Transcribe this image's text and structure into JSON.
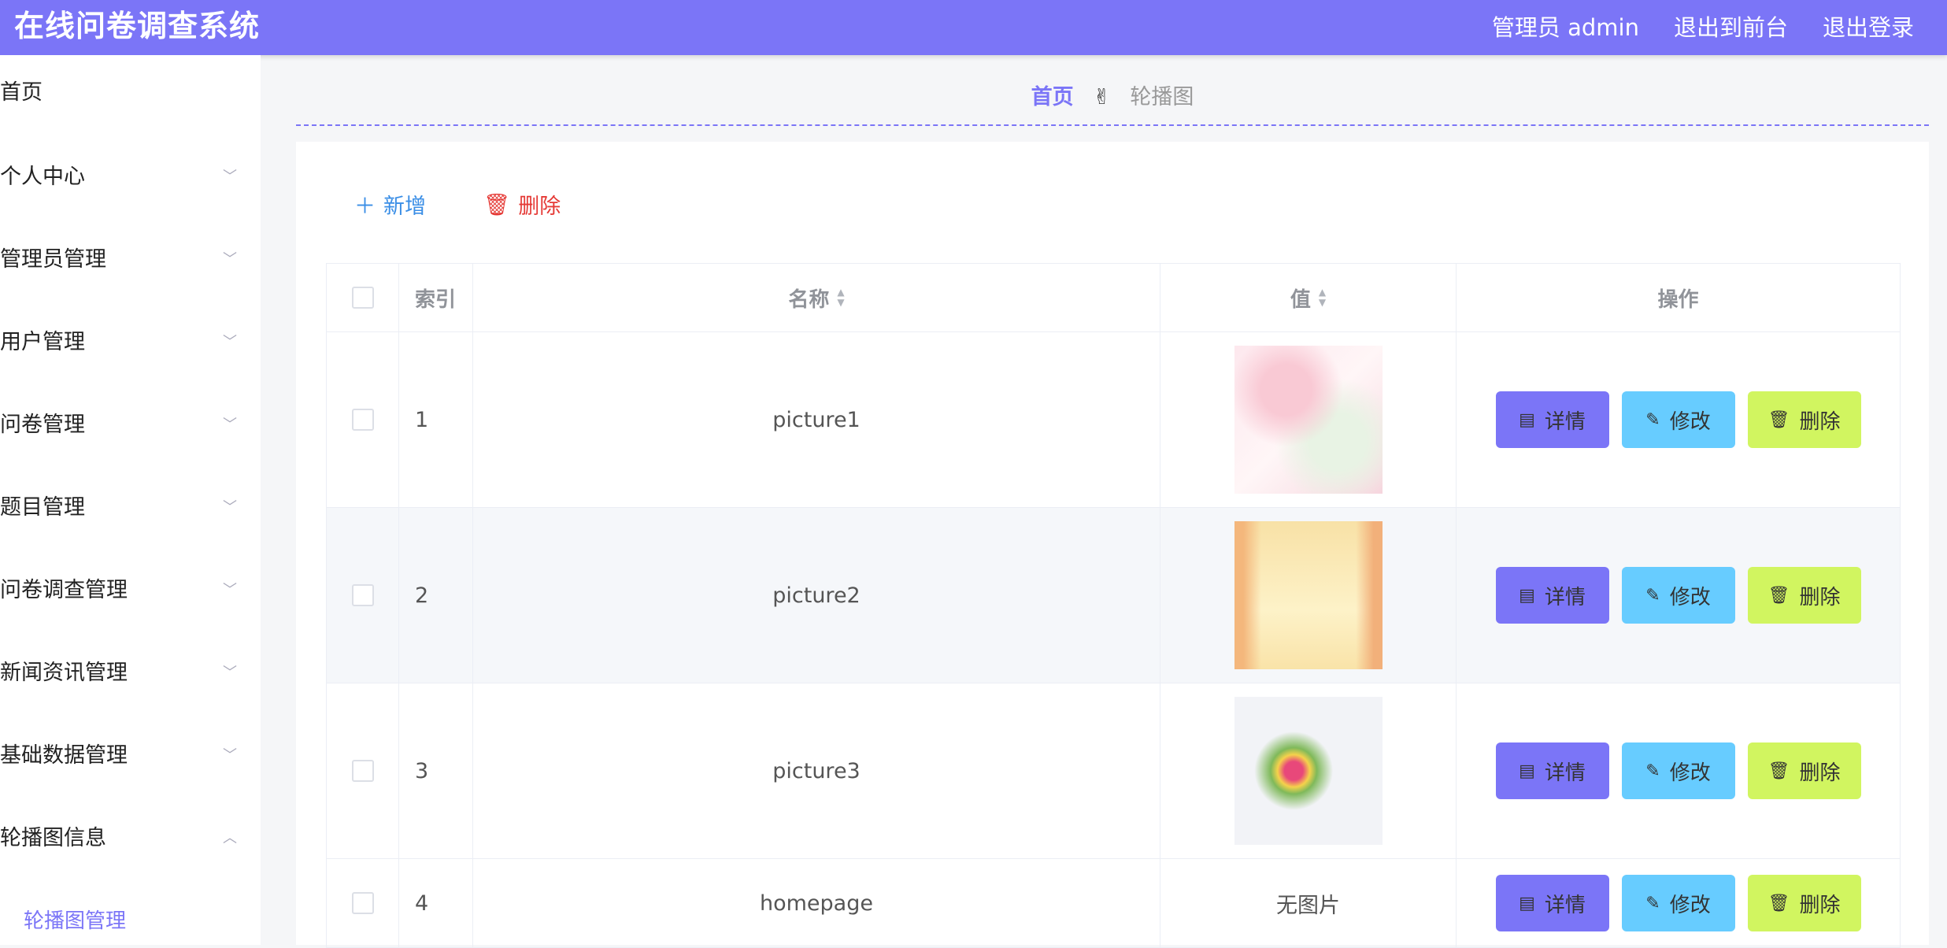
{
  "header": {
    "title": "在线问卷调查系统",
    "nav": [
      "管理员 admin",
      "退出到前台",
      "退出登录"
    ]
  },
  "sidebar": {
    "items": [
      {
        "label": "首页"
      },
      {
        "label": "个人中心"
      },
      {
        "label": "管理员管理"
      },
      {
        "label": "用户管理"
      },
      {
        "label": "问卷管理"
      },
      {
        "label": "题目管理"
      },
      {
        "label": "问卷调查管理"
      },
      {
        "label": "新闻资讯管理"
      },
      {
        "label": "基础数据管理"
      },
      {
        "label": "轮播图信息"
      }
    ],
    "sub_item": "轮播图管理"
  },
  "breadcrumb": {
    "home": "首页",
    "separator": "✌",
    "current": "轮播图"
  },
  "toolbar": {
    "add": "新增",
    "delete": "删除"
  },
  "table": {
    "headers": [
      "索引",
      "名称",
      "值",
      "操作"
    ],
    "rows": [
      {
        "index": "1",
        "name": "picture1",
        "value": "",
        "image": "t1"
      },
      {
        "index": "2",
        "name": "picture2",
        "value": "",
        "image": "t2"
      },
      {
        "index": "3",
        "name": "picture3",
        "value": "",
        "image": "t3"
      },
      {
        "index": "4",
        "name": "homepage",
        "value": "无图片",
        "image": ""
      }
    ],
    "actions": {
      "detail": "详情",
      "edit": "修改",
      "delete": "删除"
    }
  },
  "colors": {
    "brand": "#7b75f7",
    "edit": "#67ccff",
    "delete_btn": "#d1f560",
    "danger": "#e53935",
    "link": "#3a8ee6"
  }
}
